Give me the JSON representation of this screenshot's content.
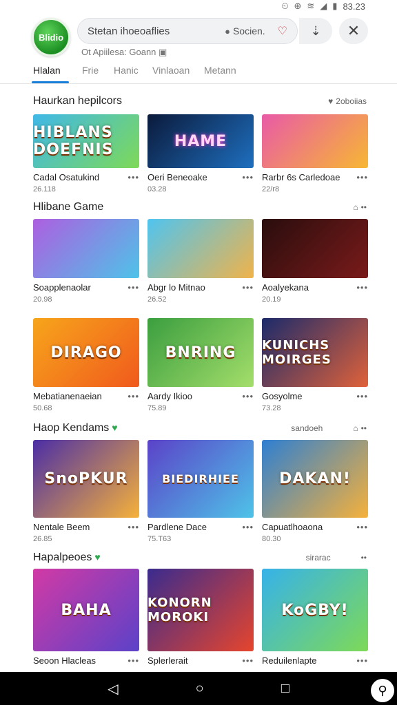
{
  "status": {
    "time": "83.23",
    "icons": [
      "⏲",
      "⊕",
      "📶",
      "▲",
      "▮"
    ]
  },
  "header": {
    "logo_text": "Blidio",
    "search_placeholder": "Stetan ihoeoaflies",
    "search_button_label": "Socien.",
    "sub_line": "Ot Apiilesa: Goann"
  },
  "tabs": [
    "Hlalan",
    "Frie",
    "Hanic",
    "Vinlaoan",
    "Metann"
  ],
  "sections": [
    {
      "title": "Haurkan hepilcors",
      "extra": "2oboiias",
      "cards": [
        {
          "thumb_text": "HIBLANS DOEFNIS",
          "title": "Cadal Osatukind",
          "meta": "26.118",
          "colors": [
            "#3fb8e8",
            "#7ed957"
          ]
        },
        {
          "thumb_text": "HAME",
          "title": "Oeri Beneoake",
          "meta": "03.28",
          "colors": [
            "#0b1a3b",
            "#1e6fbf"
          ]
        },
        {
          "thumb_text": "",
          "title": "Rarbr 6s Carledoae",
          "meta": "22/r8",
          "colors": [
            "#e95aa7",
            "#f7b733"
          ]
        }
      ]
    },
    {
      "title": "Hlibane Game",
      "extra": "",
      "cards": [
        {
          "thumb_text": "",
          "title": "Soapplenaolar",
          "meta": "20.98",
          "colors": [
            "#ad5fe0",
            "#4ec3e8"
          ]
        },
        {
          "thumb_text": "",
          "title": "Abgr lo Mitnao",
          "meta": "26.52",
          "colors": [
            "#4fc4f0",
            "#f0b34a"
          ]
        },
        {
          "thumb_text": "",
          "title": "Aoalyekana",
          "meta": "20.19",
          "colors": [
            "#2a0d0d",
            "#7a1a1a"
          ]
        }
      ]
    },
    {
      "title": "",
      "extra": "",
      "cards": [
        {
          "thumb_text": "DIRAGO",
          "title": "Mebatianenaeian",
          "meta": "50.68",
          "colors": [
            "#f7a51b",
            "#f05a1d"
          ]
        },
        {
          "thumb_text": "BNRING",
          "title": "Aardy Ikioo",
          "meta": "75.89",
          "colors": [
            "#3b9e3f",
            "#a4de6b"
          ]
        },
        {
          "thumb_text": "KUNICHS MOIRGES",
          "title": "Gosyolme",
          "meta": "73.28",
          "colors": [
            "#1b2a6b",
            "#e0623a"
          ]
        }
      ]
    },
    {
      "title": "Haop Kendams",
      "extra": "sandoeh",
      "cards": [
        {
          "thumb_text": "SnoPKUR",
          "title": "Nentale Beem",
          "meta": "26.85",
          "colors": [
            "#4b2ea6",
            "#f6b13a"
          ]
        },
        {
          "thumb_text": "BIEDIRHIEE",
          "title": "Pardlene Dace",
          "meta": "75.T63",
          "colors": [
            "#5b42c8",
            "#4ec3e8"
          ]
        },
        {
          "thumb_text": "DAKAN!",
          "title": "Capuatlhoaona",
          "meta": "80.30",
          "colors": [
            "#2d7fd3",
            "#f6b13a"
          ]
        }
      ]
    },
    {
      "title": "Hapalpeoes",
      "extra": "sirarac",
      "cards": [
        {
          "thumb_text": "BAHA",
          "title": "Seoon Hlacleas",
          "meta": "",
          "colors": [
            "#d23aa5",
            "#5b42c8"
          ]
        },
        {
          "thumb_text": "KONORN MOROKI",
          "title": "Splerlerait",
          "meta": "",
          "colors": [
            "#3a2b8e",
            "#e6452d"
          ]
        },
        {
          "thumb_text": "KoGBY!",
          "title": "Reduilenlapte",
          "meta": "",
          "colors": [
            "#36b2ea",
            "#7ed957"
          ]
        }
      ]
    }
  ],
  "nav": {
    "back": "◁",
    "home": "○",
    "recents": "□",
    "assist": "⚲"
  }
}
